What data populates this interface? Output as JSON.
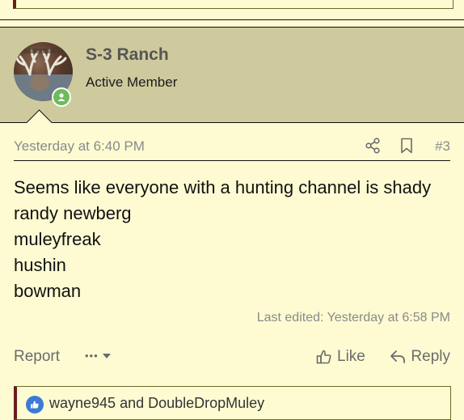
{
  "user": {
    "name": "S-3 Ranch",
    "title": "Active Member"
  },
  "post": {
    "date": "Yesterday at 6:40 PM",
    "number": "#3",
    "lines": [
      "Seems like everyone with a hunting channel is shady",
      "randy newberg",
      "muleyfreak",
      "hushin",
      "bowman"
    ],
    "edited": "Last edited: Yesterday at 6:58 PM"
  },
  "actions": {
    "report": "Report",
    "more": "•••",
    "like": "Like",
    "reply": "Reply"
  },
  "reactions": {
    "text": "wayne945 and DoubleDropMuley"
  },
  "colors": {
    "page_bg": "#fefbd2",
    "header_bg": "#ceca9e",
    "online": "#6dbb5b",
    "reaction": "#3b7bd6"
  }
}
